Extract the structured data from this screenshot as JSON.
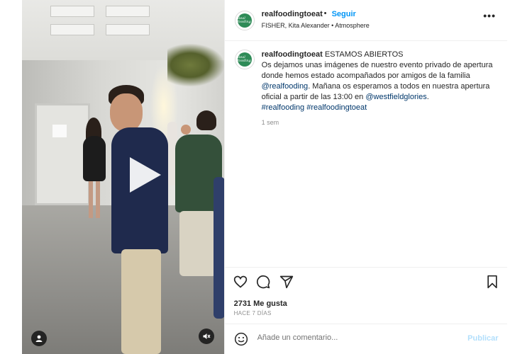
{
  "post": {
    "username": "realfoodingtoeat",
    "separator": "•",
    "follow_label": "Seguir",
    "audio": "FISHER, Kita Alexander • Atmosphere",
    "more_label": "•••",
    "avatar_text": "Real fooding"
  },
  "caption": {
    "username": "realfoodingtoeat",
    "headline": "ESTAMOS ABIERTOS",
    "text1": "Os dejamos unas imágenes de nuestro evento privado de apertura donde hemos estado acompañados por amigos de la familia ",
    "mention1": "@realfooding",
    "text2": ". Mañana os esperamos a todos en nuestra apertura oficial a partir de las 13:00 en ",
    "mention2": "@westfieldglories",
    "text3": ".",
    "hashtag1": "#realfooding",
    "hashtag2": "#realfoodingtoeat",
    "time": "1 sem"
  },
  "stats": {
    "likes": "2731 Me gusta",
    "posted": "HACE 7 DÍAS"
  },
  "comment": {
    "placeholder": "Añade un comentario...",
    "publish_label": "Publicar"
  },
  "icons": {
    "like": "heart-icon",
    "comment": "comment-bubble-icon",
    "share": "paper-plane-icon",
    "save": "bookmark-icon",
    "emoji": "smiley-icon",
    "tagged": "user-icon",
    "mute": "speaker-muted-icon",
    "play": "play-icon"
  },
  "colors": {
    "link": "#00376b",
    "follow": "#0095f6",
    "publish_disabled": "#b2dffc",
    "meta": "#8e8e8e"
  }
}
